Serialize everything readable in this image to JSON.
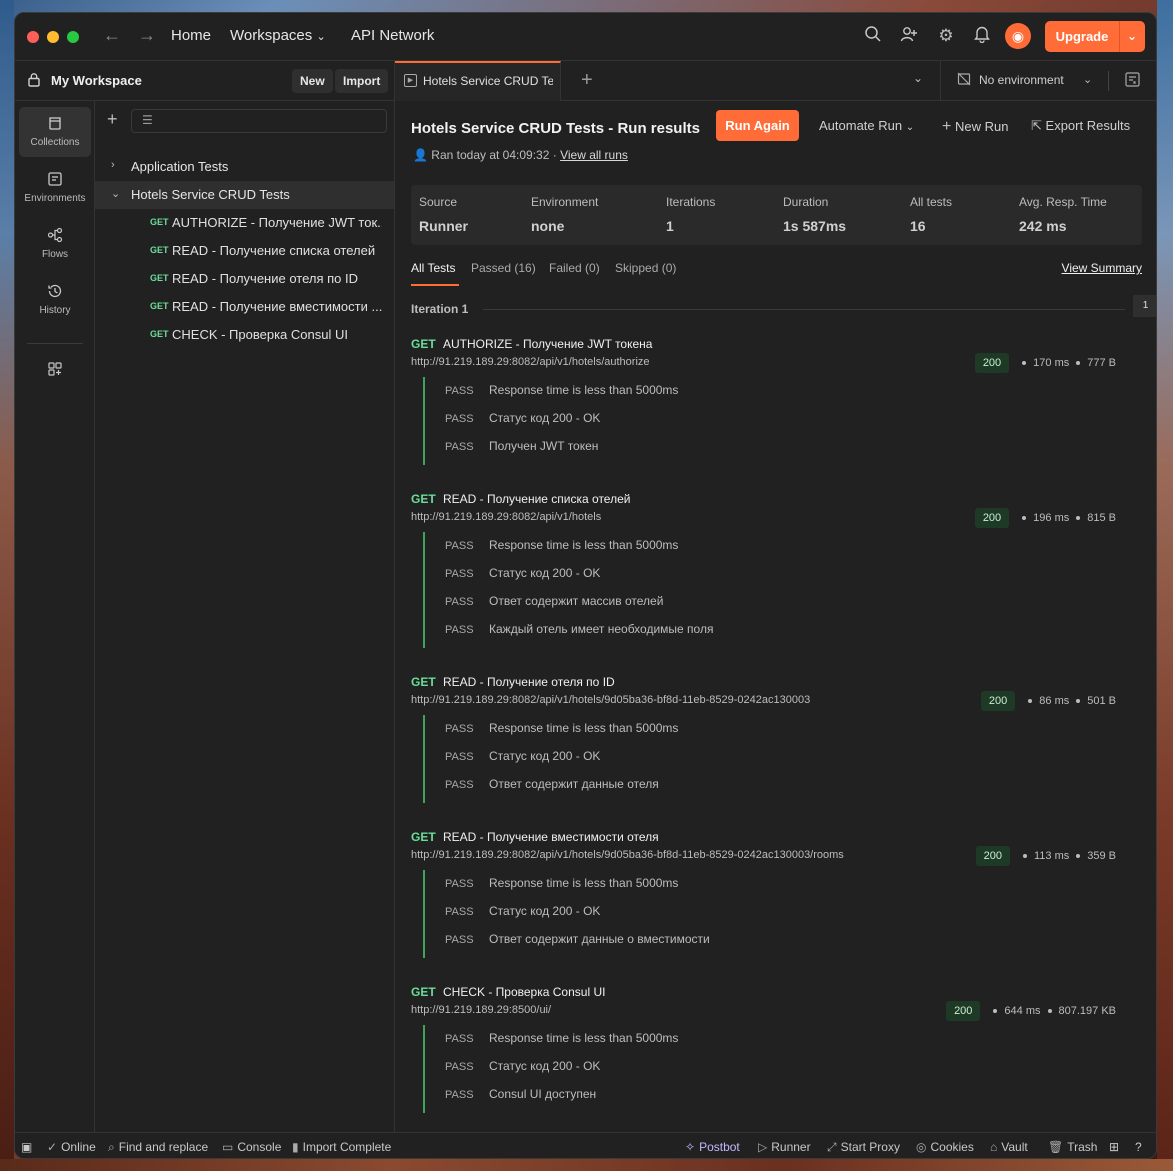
{
  "header": {
    "home": "Home",
    "workspaces": "Workspaces",
    "api_network": "API Network",
    "upgrade": "Upgrade"
  },
  "workspace": {
    "title": "My Workspace",
    "new_label": "New",
    "import_label": "Import"
  },
  "tab": {
    "label": "Hotels Service CRUD Tes"
  },
  "environment": {
    "selected": "No environment"
  },
  "rail": {
    "items": [
      {
        "label": "Collections",
        "icon": "collections-icon"
      },
      {
        "label": "Environments",
        "icon": "environments-icon"
      },
      {
        "label": "Flows",
        "icon": "flows-icon"
      },
      {
        "label": "History",
        "icon": "history-icon"
      }
    ]
  },
  "tree": {
    "collections": [
      {
        "label": "Application Tests"
      },
      {
        "label": "Hotels Service CRUD Tests"
      }
    ],
    "requests": [
      {
        "method": "GET",
        "label": "AUTHORIZE - Получение JWT ток..."
      },
      {
        "method": "GET",
        "label": "READ - Получение списка отелей"
      },
      {
        "method": "GET",
        "label": "READ - Получение отеля по ID"
      },
      {
        "method": "GET",
        "label": "READ - Получение вместимости ..."
      },
      {
        "method": "GET",
        "label": "CHECK - Проверка Consul UI"
      }
    ]
  },
  "run": {
    "title": "Hotels Service CRUD Tests - Run results",
    "run_again": "Run Again",
    "automate_run": "Automate Run",
    "new_run": "New Run",
    "export_results": "Export Results",
    "ran_info": "Ran today at 04:09:32",
    "separator": "·",
    "view_all_runs": "View all runs"
  },
  "stats": {
    "source_k": "Source",
    "source_v": "Runner",
    "env_k": "Environment",
    "env_v": "none",
    "iter_k": "Iterations",
    "iter_v": "1",
    "dur_k": "Duration",
    "dur_v": "1s 587ms",
    "all_k": "All tests",
    "all_v": "16",
    "avg_k": "Avg. Resp. Time",
    "avg_v": "242 ms"
  },
  "filters": {
    "all": "All Tests",
    "passed": "Passed (16)",
    "failed": "Failed (0)",
    "skipped": "Skipped (0)",
    "view_summary": "View Summary"
  },
  "iteration": {
    "label": "Iteration 1",
    "page": "1"
  },
  "results": [
    {
      "method": "GET",
      "name": "AUTHORIZE - Получение JWT токена",
      "url": "http://91.219.189.29:8082/api/v1/hotels/authorize",
      "code": "200",
      "time": "170 ms",
      "size": "777 B",
      "tests": [
        "Response time is less than 5000ms",
        "Статус код 200 - OK",
        "Получен JWT токен"
      ]
    },
    {
      "method": "GET",
      "name": "READ - Получение списка отелей",
      "url": "http://91.219.189.29:8082/api/v1/hotels",
      "code": "200",
      "time": "196 ms",
      "size": "815 B",
      "tests": [
        "Response time is less than 5000ms",
        "Статус код 200 - OK",
        "Ответ содержит массив отелей",
        "Каждый отель имеет необходимые поля"
      ]
    },
    {
      "method": "GET",
      "name": "READ - Получение отеля по ID",
      "url": "http://91.219.189.29:8082/api/v1/hotels/9d05ba36-bf8d-11eb-8529-0242ac130003",
      "code": "200",
      "time": "86 ms",
      "size": "501 B",
      "tests": [
        "Response time is less than 5000ms",
        "Статус код 200 - OK",
        "Ответ содержит данные отеля"
      ]
    },
    {
      "method": "GET",
      "name": "READ - Получение вместимости отеля",
      "url": "http://91.219.189.29:8082/api/v1/hotels/9d05ba36-bf8d-11eb-8529-0242ac130003/rooms",
      "code": "200",
      "time": "113 ms",
      "size": "359 B",
      "tests": [
        "Response time is less than 5000ms",
        "Статус код 200 - OK",
        "Ответ содержит данные о вместимости"
      ]
    },
    {
      "method": "GET",
      "name": "CHECK - Проверка Consul UI",
      "url": "http://91.219.189.29:8500/ui/",
      "code": "200",
      "time": "644 ms",
      "size": "807.197 KB",
      "tests": [
        "Response time is less than 5000ms",
        "Статус код 200 - OK",
        "Consul UI доступен"
      ]
    }
  ],
  "pass_label": "PASS",
  "statusbar": {
    "online": "Online",
    "find_replace": "Find and replace",
    "console": "Console",
    "import_complete": "Import Complete",
    "postbot": "Postbot",
    "runner": "Runner",
    "start_proxy": "Start Proxy",
    "cookies": "Cookies",
    "vault": "Vault",
    "trash": "Trash"
  }
}
